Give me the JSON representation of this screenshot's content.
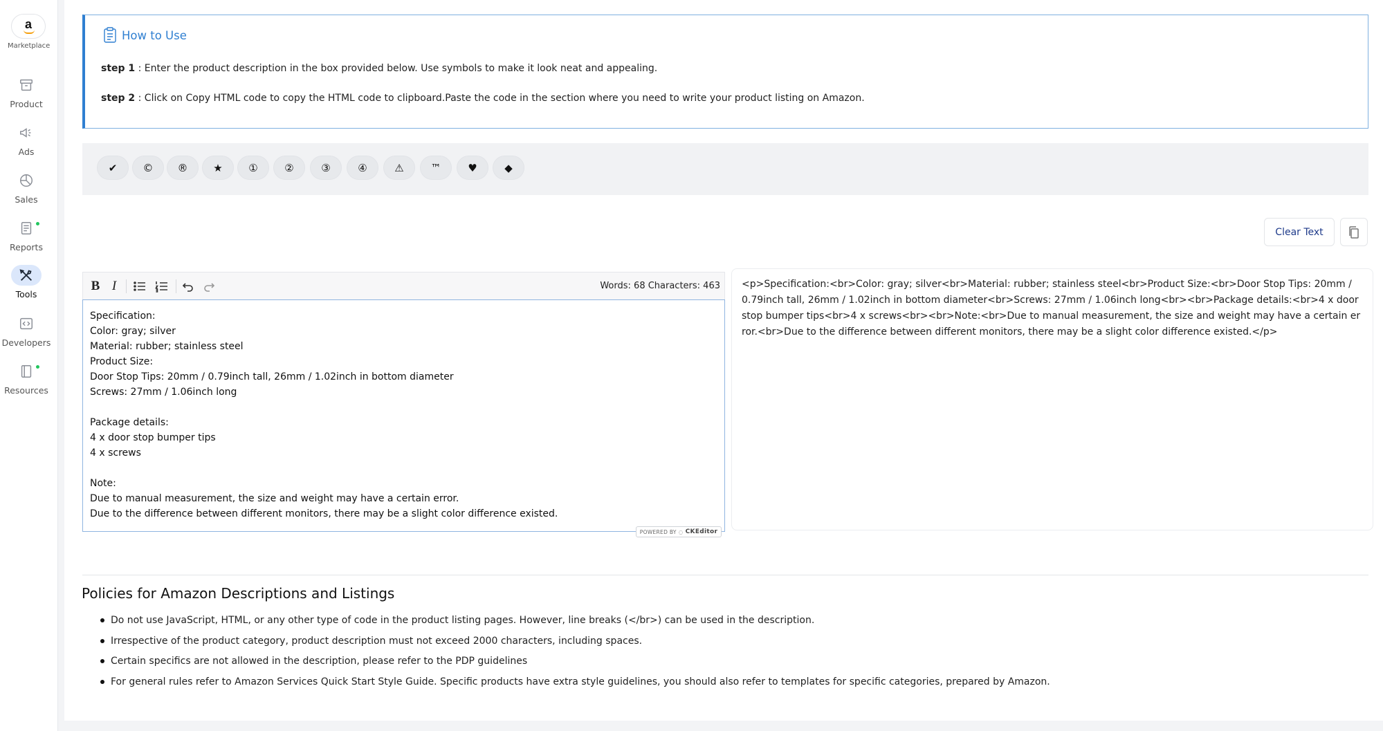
{
  "sidebar": {
    "logo_letter": "a",
    "logo_label": "Marketplace",
    "items": [
      {
        "label": "Product",
        "icon": "archive-box-icon",
        "dot": false,
        "active": false
      },
      {
        "label": "Ads",
        "icon": "megaphone-icon",
        "dot": false,
        "active": false
      },
      {
        "label": "Sales",
        "icon": "pie-chart-icon",
        "dot": false,
        "active": false
      },
      {
        "label": "Reports",
        "icon": "document-report-icon",
        "dot": true,
        "active": false
      },
      {
        "label": "Tools",
        "icon": "tools-icon",
        "dot": false,
        "active": true
      },
      {
        "label": "Developers",
        "icon": "code-icon",
        "dot": false,
        "active": false
      },
      {
        "label": "Resources",
        "icon": "book-icon",
        "dot": true,
        "active": false
      }
    ]
  },
  "howto": {
    "title": "How to Use",
    "step1_label": "step 1",
    "step1_text": " : Enter the product description in the box provided below. Use symbols to make it look neat and appealing.",
    "step2_label": "step 2",
    "step2_text": " : Click on Copy HTML code to copy the HTML code to clipboard.Paste the code in the section where you need to write your product listing on Amazon."
  },
  "symbols": [
    "✔",
    "©",
    "®",
    "★",
    "①",
    "②",
    "③",
    "④",
    "⚠",
    "™",
    "♥",
    "◆"
  ],
  "actions": {
    "clear_label": "Clear Text"
  },
  "editor": {
    "counter": "Words: 68 Characters: 463",
    "lines": [
      "Specification:",
      "Color: gray; silver",
      "Material: rubber; stainless steel",
      "Product Size:",
      "Door Stop Tips: 20mm / 0.79inch tall, 26mm / 1.02inch in bottom diameter",
      "Screws: 27mm / 1.06inch long",
      "",
      "Package details:",
      "4 x door stop bumper tips",
      "4 x screws",
      "",
      "Note:",
      "Due to manual measurement, the size and weight may have a certain error.",
      "Due to the difference between different monitors, there may be a slight color difference existed."
    ],
    "badge_prefix": "POWERED BY",
    "badge_brand": "CKEditor"
  },
  "output": {
    "html_code": "<p>Specification:<br>Color: gray; silver<br>Material: rubber; stainless steel<br>Product Size:<br>Door Stop Tips: 20mm / 0.79inch tall, 26mm / 1.02inch in bottom diameter<br>Screws: 27mm / 1.06inch long<br><br>Package details:<br>4 x door stop bumper tips<br>4 x screws<br><br>Note:<br>Due to manual measurement, the size and weight may have a certain error.<br>Due to the difference between different monitors, there may be a slight color difference existed.</p>"
  },
  "policies": {
    "title": "Policies for Amazon Descriptions and Listings",
    "items": [
      "Do not use JavaScript, HTML, or any other type of code in the product listing pages. However, line breaks (</br>) can be used in the description.",
      "Irrespective of the product category, product description must not exceed 2000 characters, including spaces.",
      "Certain specifics are not allowed in the description, please refer to the PDP guidelines",
      "For general rules refer to Amazon Services Quick Start Style Guide. Specific products have extra style guidelines, you should also refer to templates for specific categories, prepared by Amazon."
    ]
  },
  "colors": {
    "accent_blue": "#2f7fd1",
    "active_nav_bg": "#dbe7fb",
    "status_dot": "#22c55e",
    "clear_text": "#1e3a8a"
  }
}
